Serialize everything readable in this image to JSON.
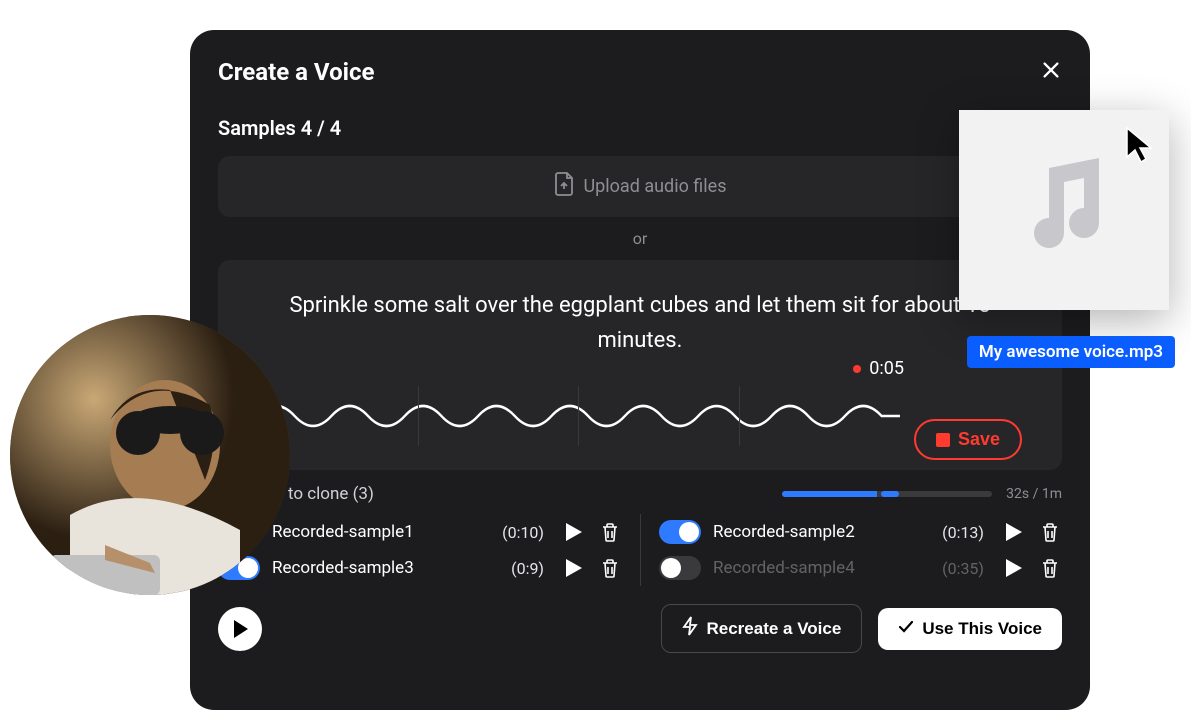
{
  "modal": {
    "title": "Create a Voice",
    "samples_label": "Samples 4 / 4",
    "upload_label": "Upload audio files",
    "or_label": "or",
    "prompt_text": "Sprinkle some salt over the eggplant cubes and let them sit for about 15 minutes.",
    "timer": "0:05",
    "save_label": "Save",
    "clone_title": "Samples to clone (3)",
    "progress_text": "32s / 1m",
    "recreate_label": "Recreate a Voice",
    "use_label": "Use This Voice"
  },
  "samples": [
    {
      "name": "Recorded-sample1",
      "duration": "(0:10)",
      "enabled": true,
      "position": "left"
    },
    {
      "name": "Recorded-sample2",
      "duration": "(0:13)",
      "enabled": true,
      "position": "right"
    },
    {
      "name": "Recorded-sample3",
      "duration": "(0:9)",
      "enabled": true,
      "position": "left"
    },
    {
      "name": "Recorded-sample4",
      "duration": "(0:35)",
      "enabled": false,
      "position": "right"
    }
  ],
  "drag": {
    "filename": "My awesome voice.mp3"
  }
}
